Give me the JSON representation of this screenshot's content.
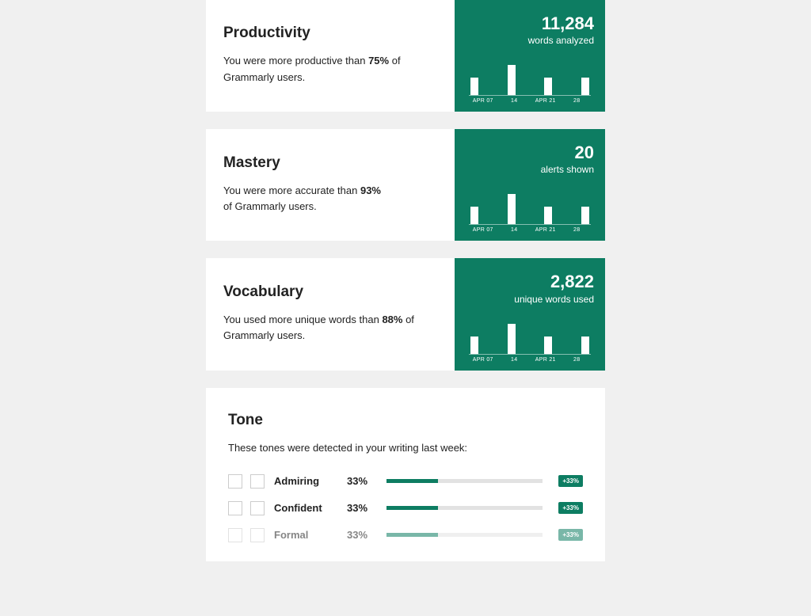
{
  "cards": [
    {
      "title": "Productivity",
      "descPre": "You were more productive than ",
      "descBold": "75%",
      "descPost": " of Grammarly users.",
      "statNumber": "11,284",
      "statLabel": "words analyzed"
    },
    {
      "title": "Mastery",
      "descPre": "You were more accurate than ",
      "descBold": "93%",
      "descPost": " of Grammarly users.",
      "statNumber": "20",
      "statLabel": "alerts shown"
    },
    {
      "title": "Vocabulary",
      "descPre": "You used more unique words than ",
      "descBold": "88%",
      "descPost": " of Grammarly users.",
      "statNumber": "2,822",
      "statLabel": "unique words used"
    }
  ],
  "chart_data": {
    "type": "bar",
    "categories": [
      "APR 07",
      "14",
      "APR 21",
      "28"
    ],
    "values": [
      22,
      38,
      22,
      22
    ],
    "notes": "Relative bar heights (pixel units) shared across all three cards; numeric axis not shown."
  },
  "tone": {
    "title": "Tone",
    "desc": "These tones were detected in your writing last week:",
    "rows": [
      {
        "name": "Admiring",
        "percent": "33%",
        "fill": 33,
        "badge": "+33%"
      },
      {
        "name": "Confident",
        "percent": "33%",
        "fill": 33,
        "badge": "+33%"
      },
      {
        "name": "Formal",
        "percent": "33%",
        "fill": 33,
        "badge": "+33%"
      }
    ]
  }
}
